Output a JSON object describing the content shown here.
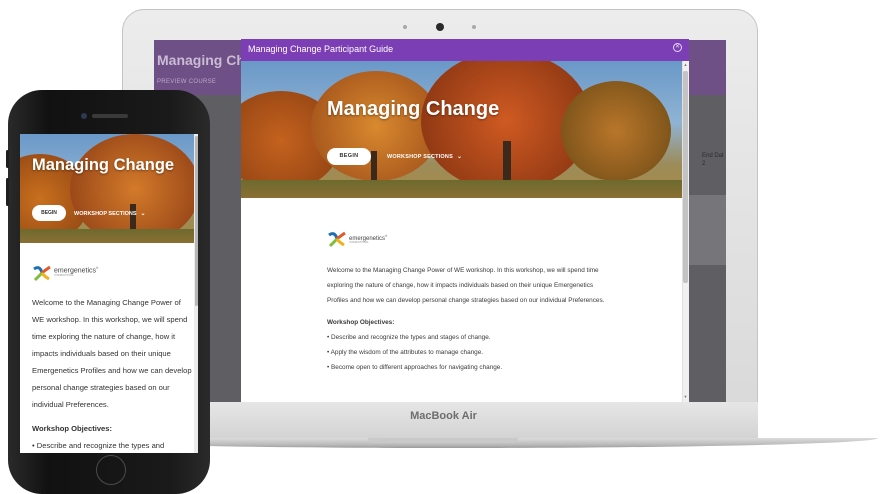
{
  "laptop": {
    "brand": "MacBook Air",
    "background_app": {
      "title": "Managing Cha",
      "subtitle": "PREVIEW COURSE",
      "end_label": "End Dat",
      "end_value": "2"
    }
  },
  "modal": {
    "title": "Managing Change Participant Guide",
    "close_icon": "close-circle-icon",
    "hero": {
      "heading": "Managing Change",
      "begin_label": "BEGIN",
      "sections_label": "WORKSHOP SECTIONS"
    },
    "logo": {
      "name": "emergenetics",
      "mark": "®",
      "tagline": "INTERNATIONAL"
    },
    "body": {
      "intro": "Welcome to the Managing Change Power of WE workshop. In this workshop, we will spend time exploring the nature of change, how it impacts individuals based on their unique Emergenetics Profiles and how we can develop personal change strategies based on our individual Preferences.",
      "objectives_heading": "Workshop Objectives:",
      "objectives": [
        "• Describe and recognize the  types  and stages of change.",
        "• Apply the wisdom of the attributes to manage change.",
        "• Become open to different approaches for navigating change."
      ]
    }
  },
  "phone": {
    "hero": {
      "heading": "Managing Change",
      "begin_label": "BEGIN",
      "sections_label": "WORKSHOP SECTIONS"
    },
    "logo": {
      "name": "emergenetics",
      "mark": "®",
      "tagline": "INTERNATIONAL"
    },
    "body": {
      "intro": "Welcome to the Managing Change Power of WE workshop. In this workshop, we will spend time exploring the nature of change, how it impacts individuals based on their unique Emergenetics Profiles and how we can develop personal change strategies based on our individual Preferences.",
      "objectives_heading": "Workshop Objectives:",
      "objectives_first": "• Describe and recognize the  types  and"
    }
  },
  "colors": {
    "modal_bar": "#7c3eb4",
    "bg_header": "#6e4f86"
  }
}
